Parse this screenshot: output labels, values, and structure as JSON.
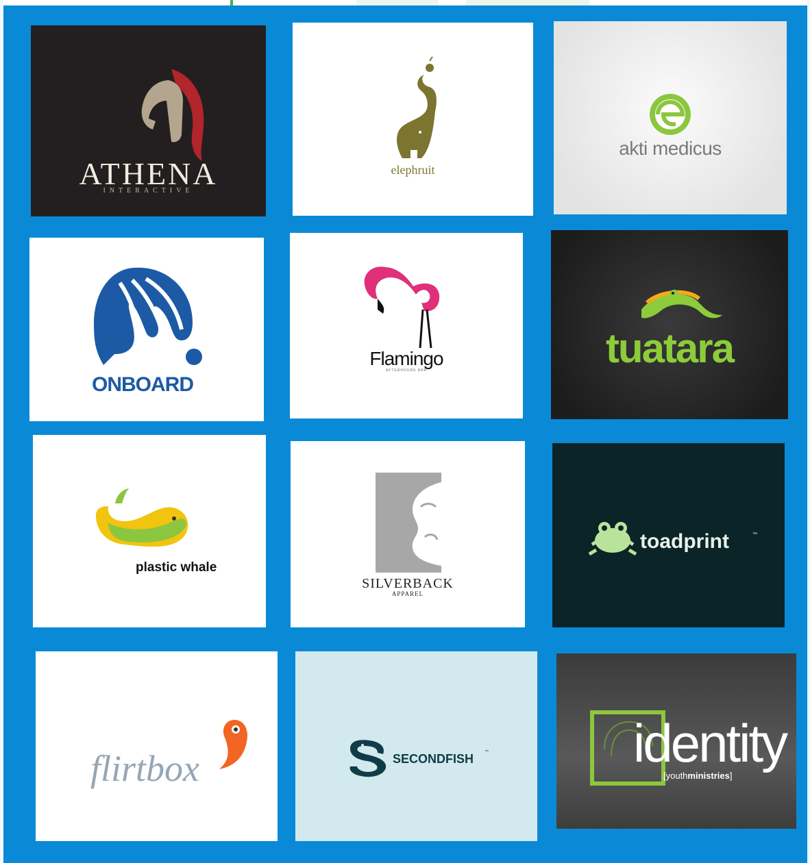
{
  "logos": {
    "athena": {
      "name": "ATHENA",
      "tagline": "INTERACTIVE"
    },
    "elephruit": {
      "name": "elephruit"
    },
    "akti": {
      "name": "akti medicus"
    },
    "onboard": {
      "name": "ONBOARD"
    },
    "flamingo": {
      "name": "Flamingo",
      "tagline": "AFTERHOURS BAR"
    },
    "tuatara": {
      "name": "tuatara"
    },
    "whale": {
      "name": "plastic whale"
    },
    "silverback": {
      "name": "SILVERBACK",
      "tagline": "APPAREL"
    },
    "toadprint": {
      "name": "toadprint",
      "tm": "™"
    },
    "flirtbox": {
      "name": "flirtbox"
    },
    "secondfish": {
      "name": "SECONDFISH",
      "tm": "™"
    },
    "identity": {
      "name": "identity",
      "tag_open": "[youth",
      "tag_bold": "ministries",
      "tag_close": "]"
    }
  },
  "colors": {
    "background": "#0a8ad6",
    "athena_bg": "#231f20",
    "athena_plume": "#b1252b",
    "elephruit_olive": "#7b7530",
    "akti_green": "#8cc63f",
    "onboard_blue": "#1d5aa6",
    "flamingo_pink": "#e0307a",
    "tuatara_green": "#8ccc3a",
    "whale_yellow": "#f1c40f",
    "silverback_grey": "#a7a7a7",
    "toadprint_bg": "#0b2428",
    "flirtbox_orange": "#f26522",
    "secondfish_bg": "#d2e9ee",
    "identity_green": "#8dc63f"
  }
}
